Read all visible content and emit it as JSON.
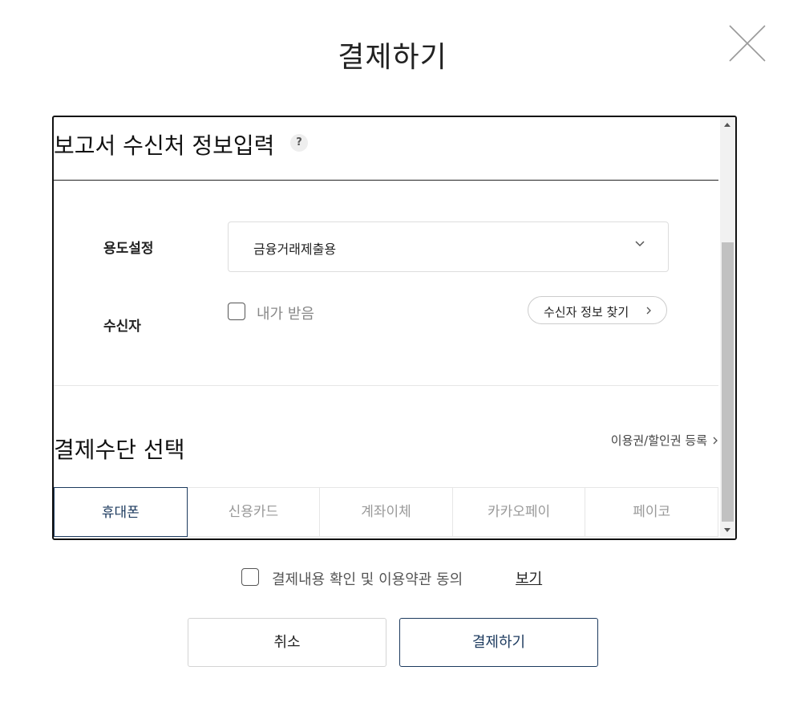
{
  "modal": {
    "title": "결제하기",
    "close_icon": "close-icon"
  },
  "recipient_section": {
    "title": "보고서 수신처 정보입력",
    "help_icon": "?",
    "purpose": {
      "label": "용도설정",
      "selected": "금융거래제출용"
    },
    "recipient": {
      "label": "수신자",
      "self_receive_label": "내가 받음",
      "self_receive_checked": false,
      "find_button": "수신자 정보 찾기"
    }
  },
  "payment_section": {
    "title": "결제수단 선택",
    "voucher_link": "이용권/할인권 등록",
    "tabs": [
      {
        "label": "휴대폰",
        "active": true
      },
      {
        "label": "신용카드",
        "active": false
      },
      {
        "label": "계좌이체",
        "active": false
      },
      {
        "label": "카카오페이",
        "active": false
      },
      {
        "label": "페이코",
        "active": false
      }
    ]
  },
  "agreement": {
    "label": "결제내용 확인 및 이용약관 동의",
    "checked": false,
    "view_link": "보기"
  },
  "actions": {
    "cancel": "취소",
    "pay": "결제하기"
  },
  "colors": {
    "accent": "#1c3a5e",
    "border": "#dddddd"
  }
}
